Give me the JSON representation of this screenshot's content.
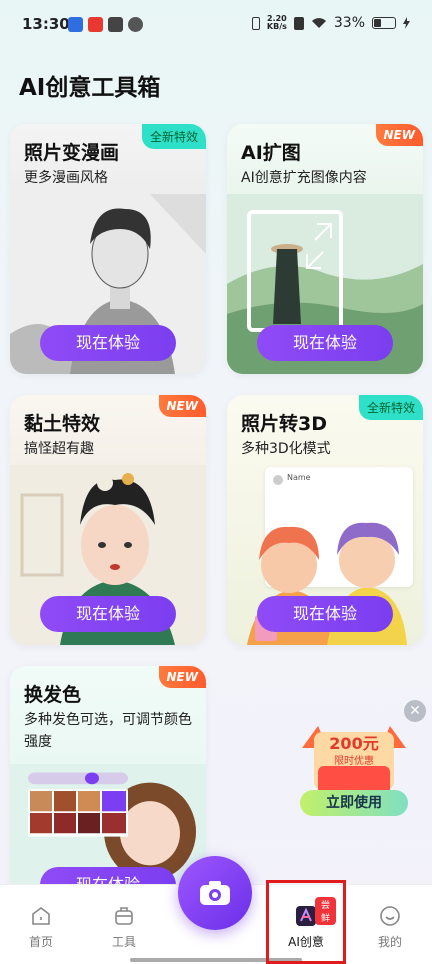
{
  "status_bar": {
    "time": "13:30",
    "net_speed_value": "2.20",
    "net_speed_unit": "KB/s",
    "battery": "33%",
    "battery_level": 0.33
  },
  "page": {
    "title": "AI创意工具箱"
  },
  "cards": [
    {
      "title": "照片变漫画",
      "subtitle": "更多漫画风格",
      "badge": "全新特效",
      "button": "现在体验"
    },
    {
      "title": "AI扩图",
      "subtitle": "AI创意扩充图像内容",
      "badge": "NEW",
      "button": "现在体验"
    },
    {
      "title": "黏土特效",
      "subtitle": "搞怪超有趣",
      "badge": "NEW",
      "button": "现在体验"
    },
    {
      "title": "照片转3D",
      "subtitle": "多种3D化模式",
      "badge": "全新特效",
      "button": "现在体验",
      "mock_name": "Name"
    },
    {
      "title": "换发色",
      "subtitle": "多种发色可选，可调节颜色强度",
      "badge": "NEW",
      "button": "现在体验"
    }
  ],
  "promo": {
    "amount": "200元",
    "caption": "限时优惠",
    "button": "立即使用"
  },
  "bottom_nav": {
    "items": [
      {
        "label": "首页",
        "icon": "home-icon"
      },
      {
        "label": "工具",
        "icon": "toolbox-icon"
      },
      {
        "label": "AI创意",
        "icon": "ai-creative-icon",
        "tag": "尝鲜"
      },
      {
        "label": "我的",
        "icon": "profile-icon"
      }
    ]
  },
  "colors": {
    "accent_purple": "#7b3ef0",
    "badge_teal": "#2fe0c8",
    "badge_orange": "#ff5b2d",
    "highlight_red": "#e01b1b"
  }
}
